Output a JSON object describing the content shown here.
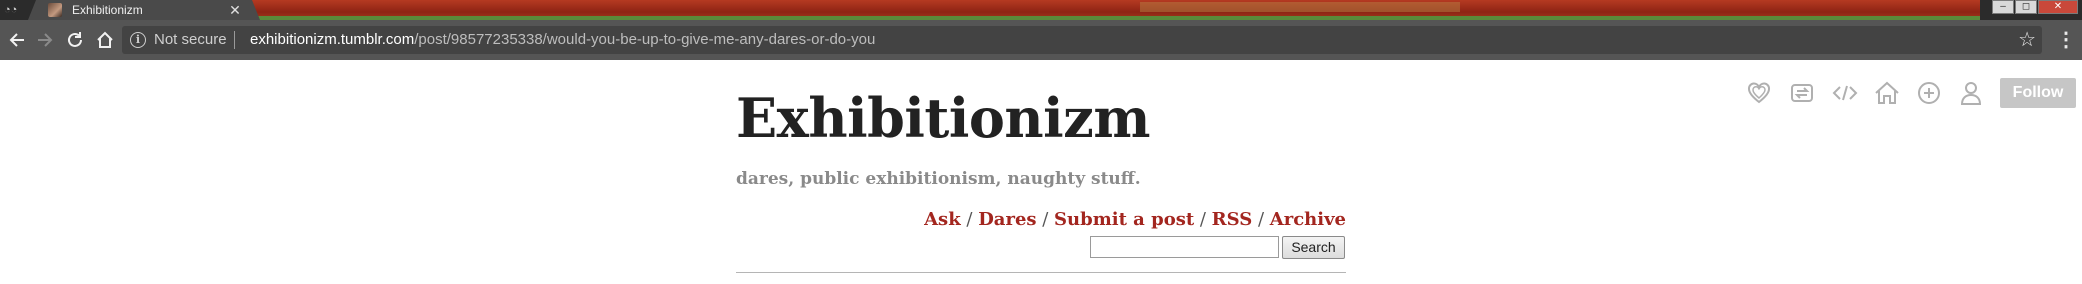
{
  "browser": {
    "tab": {
      "title": "Exhibitionizm",
      "favicon": "blog-avatar-icon",
      "close_glyph": "✕"
    },
    "incognito_glyph": "◔◔",
    "window_controls": {
      "minimize": "–",
      "maximize": "◻",
      "close": "✕"
    },
    "security": {
      "icon": "info-icon",
      "label": "Not secure"
    },
    "url": {
      "host": "exhibitionizm.tumblr.com",
      "path": "/post/98577235338/would-you-be-up-to-give-me-any-dares-or-do-you"
    },
    "star_glyph": "☆",
    "menu_glyph": "⋮"
  },
  "blog": {
    "title": "Exhibitionizm",
    "description": "dares, public exhibitionism, naughty stuff.",
    "nav": {
      "ask": "Ask",
      "dares": "Dares",
      "submit": "Submit a post",
      "rss": "RSS",
      "archive": "Archive",
      "separator": " / "
    },
    "search": {
      "value": "",
      "button_label": "Search"
    }
  },
  "tumblr_controls": {
    "icons": [
      "heart-icon",
      "reblog-icon",
      "embed-icon",
      "home-icon",
      "plus-icon",
      "user-icon"
    ],
    "follow_label": "Follow"
  },
  "colors": {
    "link": "#a3261f",
    "title": "#222222",
    "description": "#8a8a8a",
    "toolbar": "#555555",
    "follow_button": "#c6c6c6"
  }
}
